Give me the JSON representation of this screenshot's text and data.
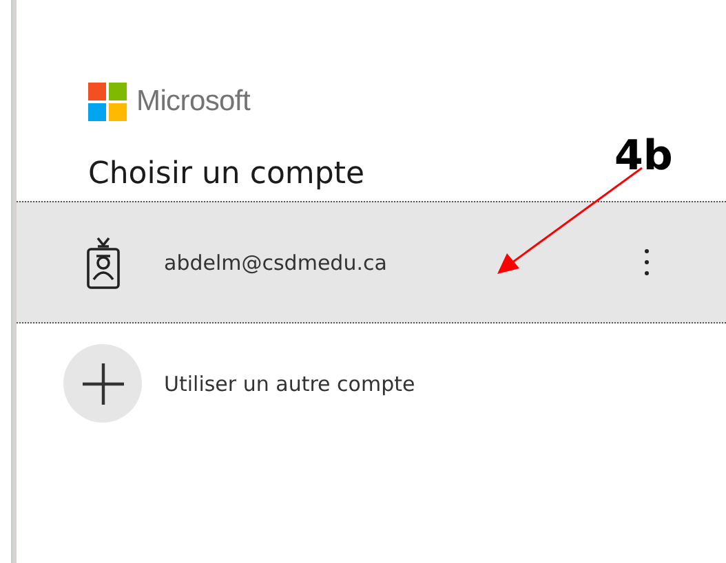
{
  "brand": {
    "name": "Microsoft"
  },
  "heading": "Choisir un compte",
  "accounts": [
    {
      "kind": "account",
      "label": "abdelm@csdmedu.ca",
      "selected": true,
      "has_menu": true
    },
    {
      "kind": "add",
      "label": "Utiliser un autre compte",
      "selected": false,
      "has_menu": false
    }
  ],
  "annotation": {
    "label": "4b"
  }
}
